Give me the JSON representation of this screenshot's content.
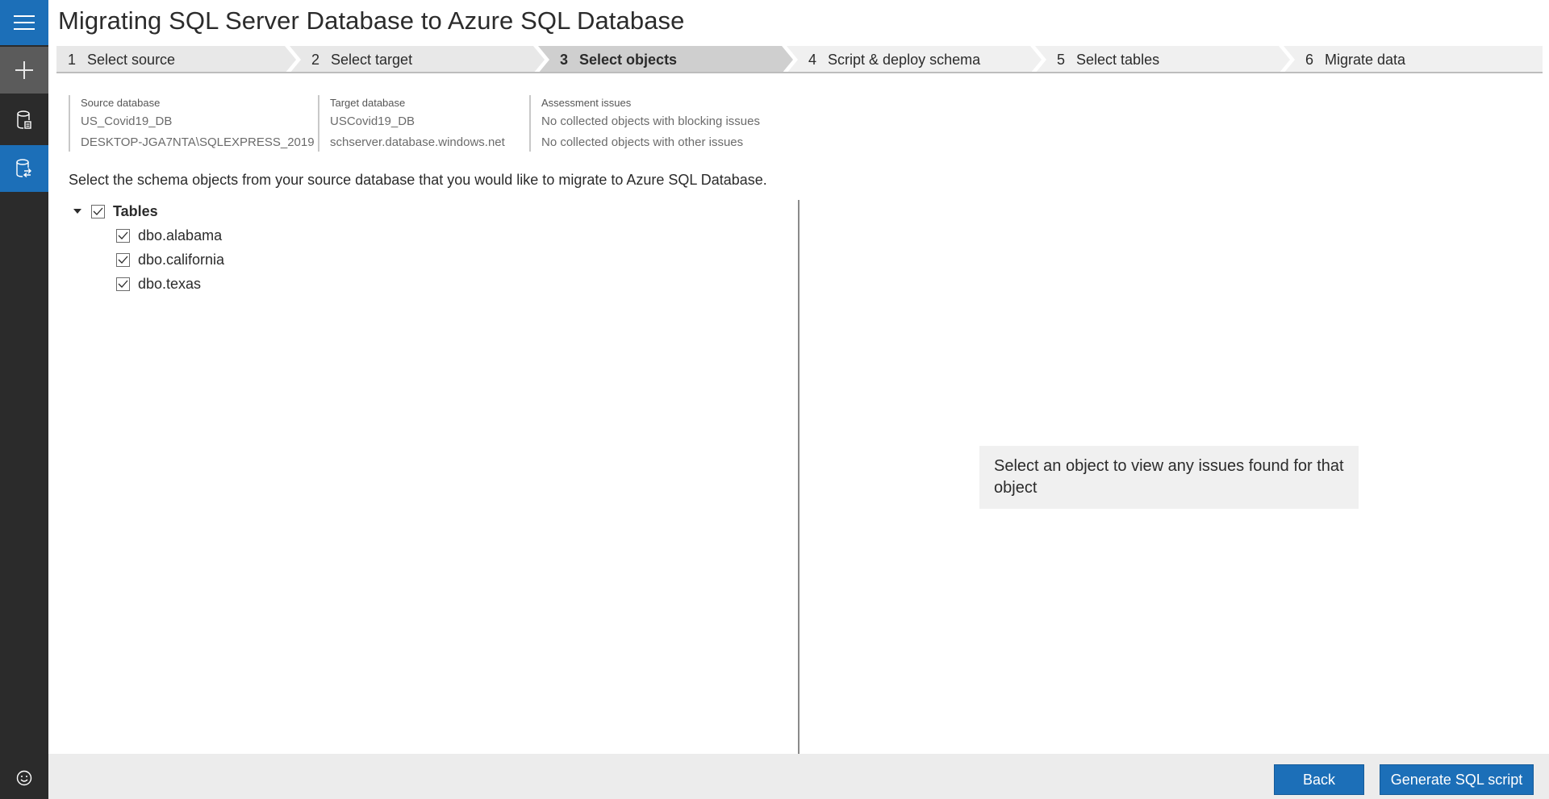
{
  "window": {
    "title": "Migrating SQL Server Database to Azure SQL Database"
  },
  "rail": {
    "icons": [
      "menu-icon",
      "plus-icon",
      "database-icon",
      "migration-icon",
      "smiley-icon"
    ]
  },
  "steps": [
    {
      "num": "1",
      "label": "Select source",
      "completed": true
    },
    {
      "num": "2",
      "label": "Select target",
      "completed": true
    },
    {
      "num": "3",
      "label": "Select objects",
      "active": true
    },
    {
      "num": "4",
      "label": "Script & deploy schema"
    },
    {
      "num": "5",
      "label": "Select tables"
    },
    {
      "num": "6",
      "label": "Migrate data"
    }
  ],
  "info": {
    "source": {
      "label": "Source database",
      "name": "US_Covid19_DB",
      "server": "DESKTOP-JGA7NTA\\SQLEXPRESS_2019"
    },
    "target": {
      "label": "Target database",
      "name": "USCovid19_DB",
      "server": "schserver.database.windows.net"
    },
    "assessment": {
      "label": "Assessment issues",
      "blocking": "No collected objects with blocking issues",
      "other": "No collected objects with other issues"
    }
  },
  "instruction": "Select the schema objects from your source database that you would like to migrate to Azure SQL Database.",
  "tree": {
    "root": {
      "label": "Tables",
      "checked": true,
      "expanded": true
    },
    "items": [
      {
        "label": "dbo.alabama",
        "checked": true
      },
      {
        "label": "dbo.california",
        "checked": true
      },
      {
        "label": "dbo.texas",
        "checked": true
      }
    ]
  },
  "detail_hint": "Select an object to view any issues found for that object",
  "footer": {
    "back_label": "Back",
    "generate_label": "Generate SQL script"
  },
  "colors": {
    "accent": "#1c6fb8",
    "rail": "#2b2b2b",
    "step_active": "#cfcfcf",
    "step_done": "#e8e8e8"
  }
}
